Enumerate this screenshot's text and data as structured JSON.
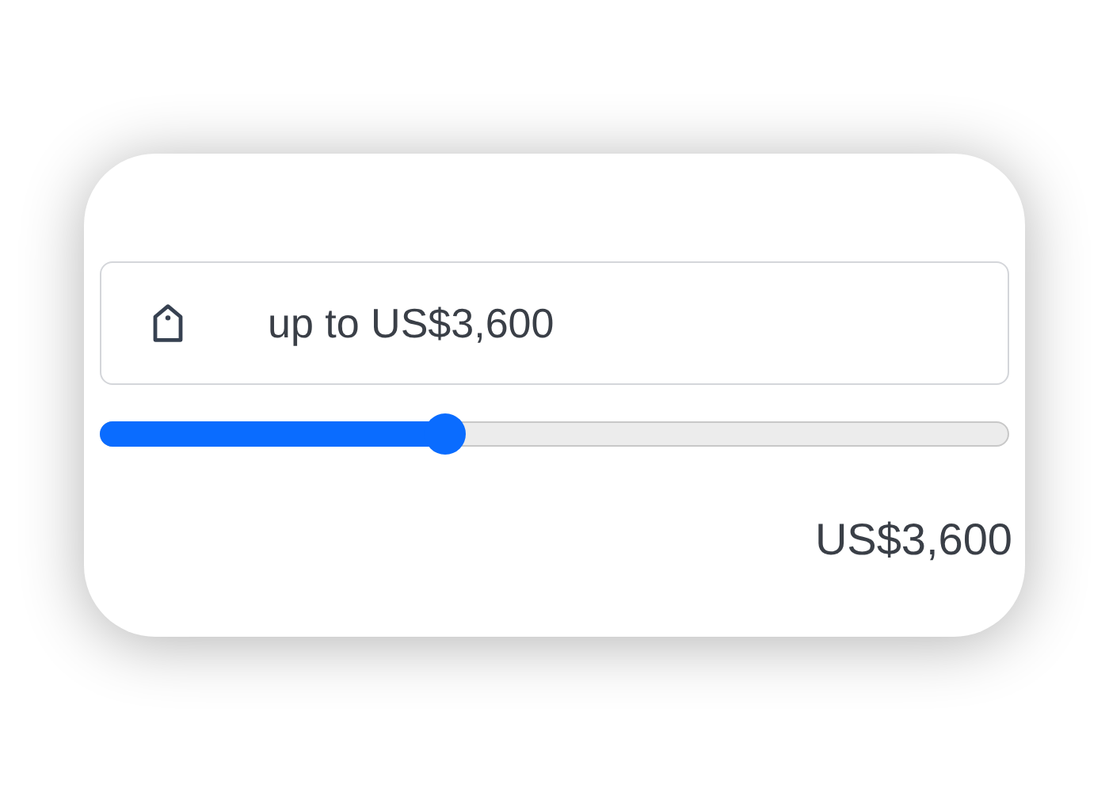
{
  "price_field": {
    "value": "up to US$3,600"
  },
  "slider": {
    "level": 0.38
  },
  "max_label": "US$3,600"
}
